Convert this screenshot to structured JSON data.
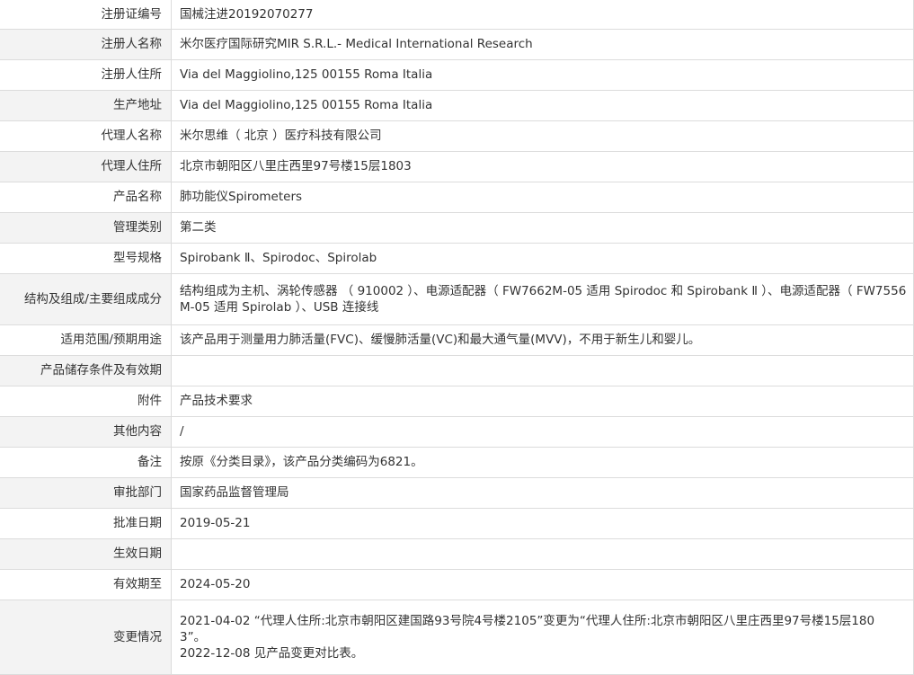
{
  "rows": [
    {
      "label": "注册证编号",
      "value": [
        "国械注进20192070277"
      ]
    },
    {
      "label": "注册人名称",
      "value": [
        "米尔医疗国际研究MIR S.R.L.- Medical International Research"
      ]
    },
    {
      "label": "注册人住所",
      "value": [
        "Via del Maggiolino,125 00155 Roma Italia"
      ]
    },
    {
      "label": "生产地址",
      "value": [
        "Via del Maggiolino,125 00155 Roma Italia"
      ]
    },
    {
      "label": "代理人名称",
      "value": [
        "米尔思维（ 北京 ）医疗科技有限公司"
      ]
    },
    {
      "label": "代理人住所",
      "value": [
        "北京市朝阳区八里庄西里97号楼15层1803"
      ]
    },
    {
      "label": "产品名称",
      "value": [
        "肺功能仪Spirometers"
      ]
    },
    {
      "label": "管理类别",
      "value": [
        "第二类"
      ]
    },
    {
      "label": "型号规格",
      "value": [
        "Spirobank Ⅱ、Spirodoc、Spirolab"
      ]
    },
    {
      "label": "结构及组成/主要组成成分",
      "value": [
        "结构组成为主机、涡轮传感器 （ 910002 ）、电源适配器（ FW7662M-05 适用 Spirodoc 和 Spirobank Ⅱ ）、电源适配器（ FW7556",
        "M-05 适用 Spirolab ）、USB 连接线"
      ]
    },
    {
      "label": "适用范围/预期用途",
      "value": [
        "该产品用于测量用力肺活量(FVC)、缓慢肺活量(VC)和最大通气量(MVV)，不用于新生儿和婴儿。"
      ]
    },
    {
      "label": "产品储存条件及有效期",
      "value": [
        ""
      ]
    },
    {
      "label": "附件",
      "value": [
        "产品技术要求"
      ]
    },
    {
      "label": "其他内容",
      "value": [
        "/"
      ]
    },
    {
      "label": "备注",
      "value": [
        "按原《分类目录》，该产品分类编码为6821。"
      ]
    },
    {
      "label": "审批部门",
      "value": [
        "国家药品监督管理局"
      ]
    },
    {
      "label": "批准日期",
      "value": [
        "2019-05-21"
      ]
    },
    {
      "label": "生效日期",
      "value": [
        ""
      ]
    },
    {
      "label": "有效期至",
      "value": [
        "2024-05-20"
      ]
    },
    {
      "label": "变更情况",
      "value": [
        "2021-04-02 “代理人住所:北京市朝阳区建国路93号院4号楼2105”变更为“代理人住所:北京市朝阳区八里庄西里97号楼15层180",
        "3”。",
        "2022-12-08 见产品变更对比表。"
      ]
    }
  ]
}
